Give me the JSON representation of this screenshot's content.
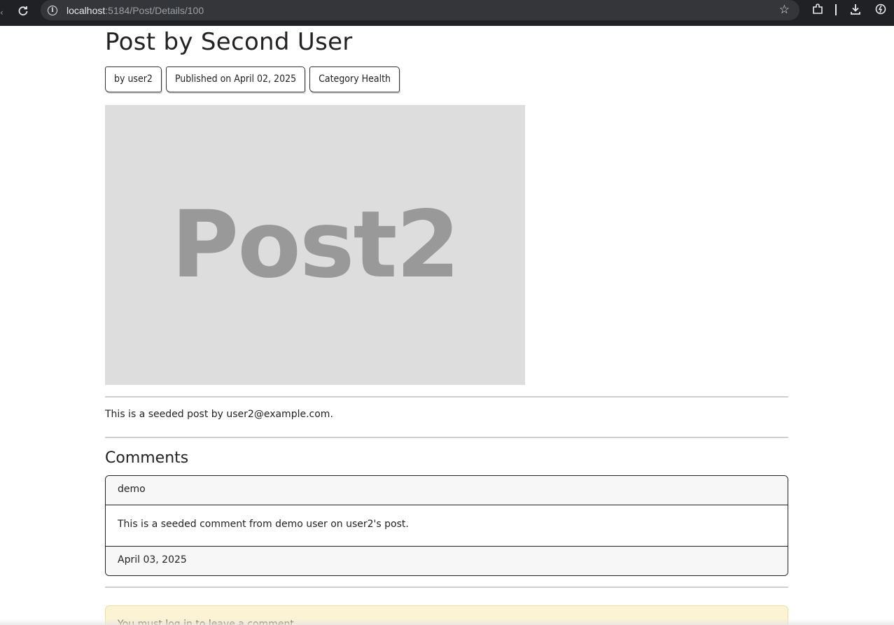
{
  "browser": {
    "url_host": "localhost",
    "url_path": ":5184/Post/Details/100",
    "icons": [
      "reload-icon",
      "site-info-icon",
      "bookmark-star-icon",
      "extensions-icon",
      "download-icon",
      "performance-icon"
    ]
  },
  "post": {
    "title": "Post by Second User",
    "author_badge": "by user2",
    "published_badge": "Published on April 02, 2025",
    "category_badge": "Category Health",
    "image_text": "Post2",
    "body": "This is a seeded post by user2@example.com."
  },
  "comments": {
    "heading": "Comments",
    "items": [
      {
        "author": "demo",
        "text": "This is a seeded comment from demo user on user2's post.",
        "date": "April 03, 2025"
      }
    ]
  },
  "alert": {
    "text": "You must log in to leave a comment."
  },
  "colors": {
    "chrome_bg": "#202124",
    "omnibox_bg": "#35363a",
    "placeholder_bg": "#dddddd",
    "placeholder_text": "#999999",
    "alert_bg": "#fcf3d4"
  }
}
